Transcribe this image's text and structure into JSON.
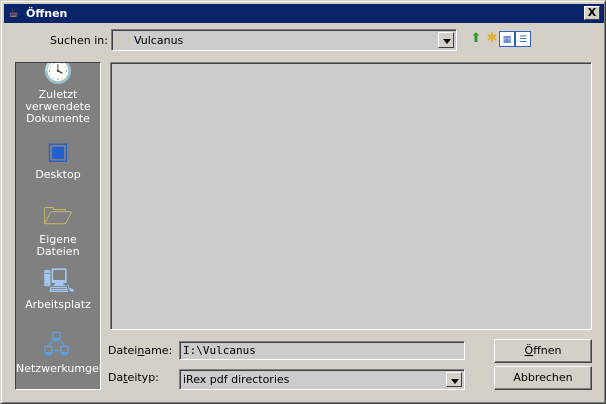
{
  "window": {
    "title": "Öffnen",
    "icon": "java-cup-icon",
    "close": "X"
  },
  "look_in": {
    "label": "Suchen in:",
    "value": "Vulcanus",
    "folder_icon": "folder-icon"
  },
  "toolbar": [
    "up-folder-icon",
    "new-folder-icon",
    "list-view-icon",
    "details-view-icon"
  ],
  "sidebar": {
    "items": [
      {
        "label": "Zuletzt verwendete Dokumente",
        "icon": "recent-documents-icon"
      },
      {
        "label": "Desktop",
        "icon": "desktop-icon"
      },
      {
        "label": "Eigene Dateien",
        "icon": "my-documents-icon"
      },
      {
        "label": "Arbeitsplatz",
        "icon": "my-computer-icon"
      },
      {
        "label": "Netzwerkumgebu",
        "icon": "network-icon"
      }
    ]
  },
  "filename": {
    "label_pre": "Datei",
    "label_u": "n",
    "label_post": "ame:",
    "value": "I:\\Vulcanus"
  },
  "filetype": {
    "label_pre": "Da",
    "label_u": "t",
    "label_post": "eityp:",
    "value": "iRex pdf directories"
  },
  "buttons": {
    "open_u": "Ö",
    "open_rest": "ffnen",
    "cancel": "Abbrechen"
  }
}
